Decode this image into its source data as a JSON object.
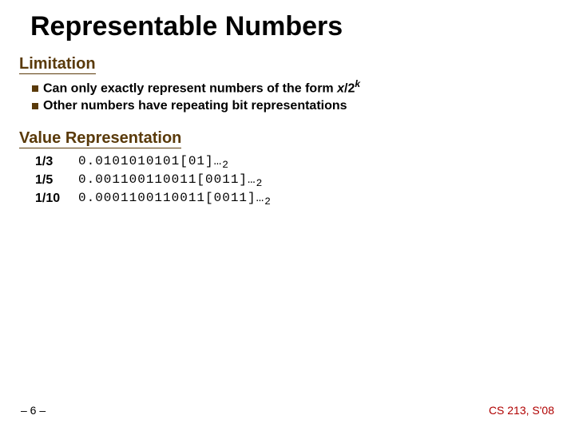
{
  "title": "Representable Numbers",
  "sections": {
    "limitation": {
      "heading": "Limitation",
      "bullets": {
        "b0_pre": "Can only exactly represent numbers of the form ",
        "b0_var": "x",
        "b0_mid": "/2",
        "b0_exp": "k",
        "b1": "Other numbers have repeating bit representations"
      }
    },
    "valuerep": {
      "heading": "Value Representation",
      "rows": [
        {
          "val": "1/3",
          "rep": "0.0101010101[01]…",
          "sub": "2"
        },
        {
          "val": "1/5",
          "rep": "0.001100110011[0011]…",
          "sub": "2"
        },
        {
          "val": "1/10",
          "rep": "0.0001100110011[0011]…",
          "sub": "2"
        }
      ]
    }
  },
  "footer": {
    "left": "– 6 –",
    "right": "CS 213, S'08"
  }
}
